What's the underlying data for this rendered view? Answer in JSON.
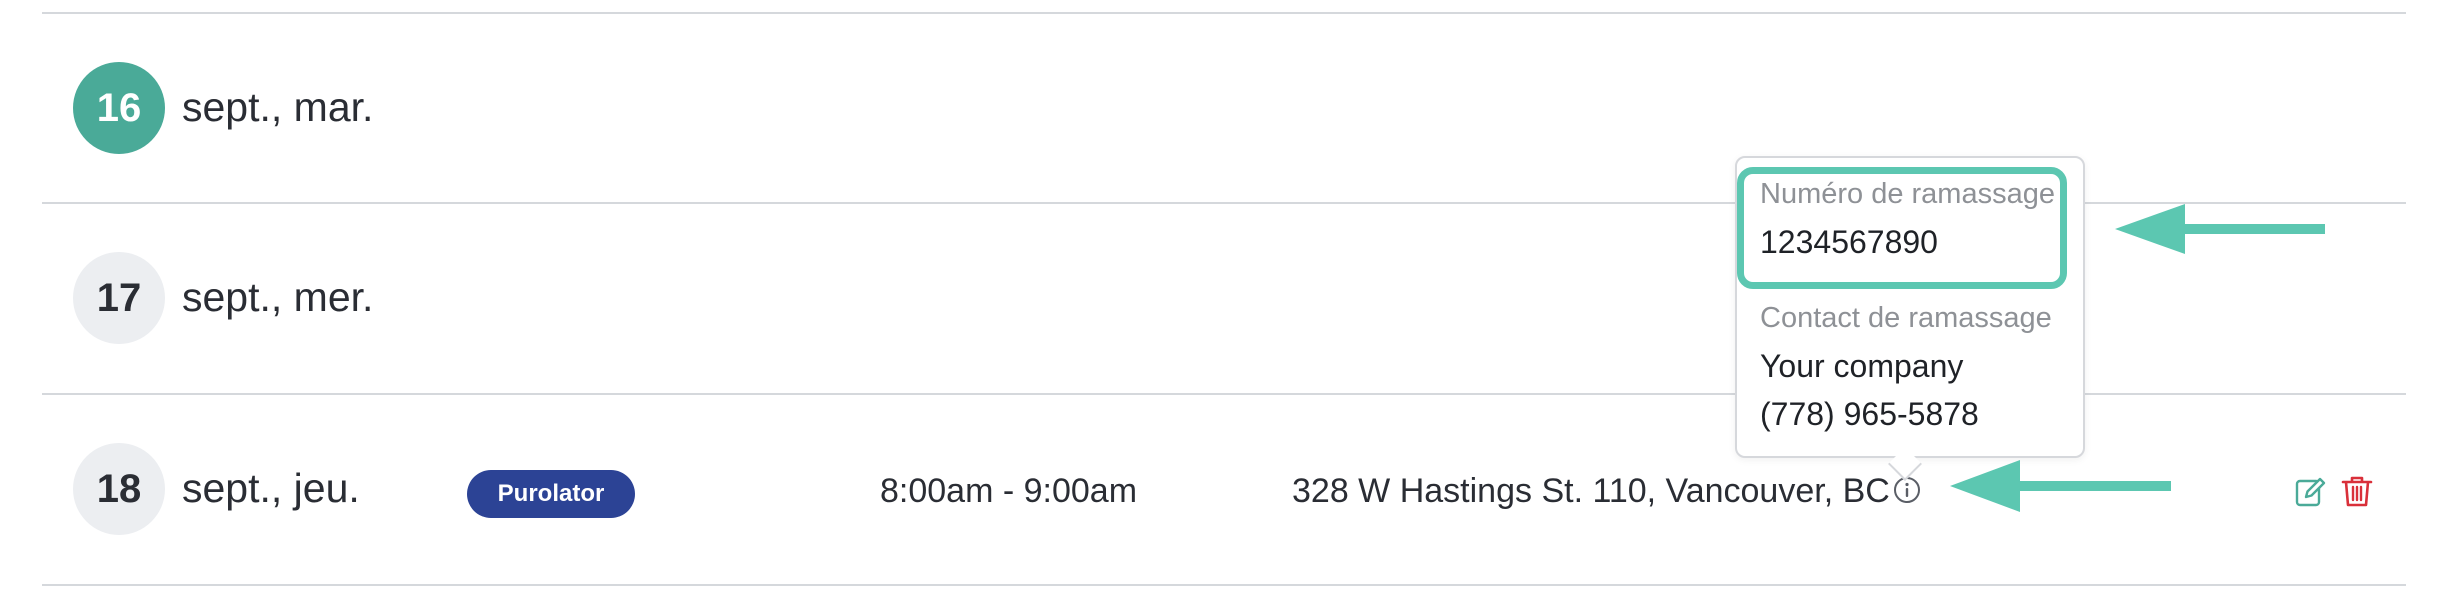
{
  "rows": [
    {
      "day": "16",
      "label": "sept., mar.",
      "active": true
    },
    {
      "day": "17",
      "label": "sept., mer.",
      "active": false
    },
    {
      "day": "18",
      "label": "sept., jeu.",
      "active": false,
      "carrier": "Purolator",
      "time_window": "8:00am - 9:00am",
      "address": "328 W Hastings St. 110, Vancouver, BC"
    }
  ],
  "tooltip": {
    "pickup_number_label": "Numéro de ramassage",
    "pickup_number_value": "1234567890",
    "pickup_contact_label": "Contact de ramassage",
    "pickup_contact_company": "Your company",
    "pickup_contact_phone": "(778) 965-5878"
  },
  "icons": {
    "info": "info-icon",
    "edit": "edit-icon",
    "delete": "trash-icon"
  },
  "colors": {
    "active_date": "#4aaa98",
    "carrier_badge": "#2c4395",
    "annotation": "#5cc7b1",
    "edit_icon": "#4aaa98",
    "delete_icon": "#d9303a"
  }
}
